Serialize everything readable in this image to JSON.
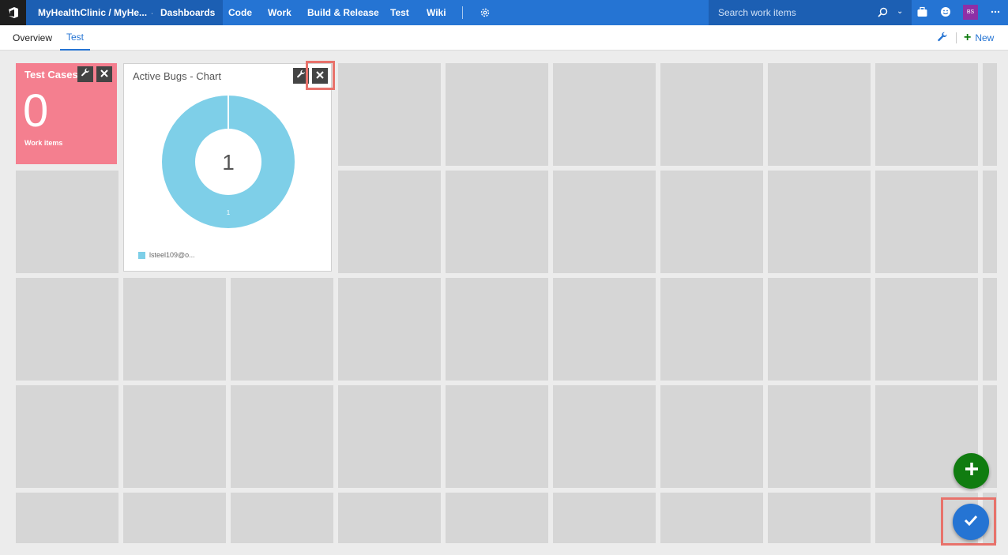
{
  "topbar": {
    "project": "MyHealthClinic / MyHe...",
    "nav": [
      "Dashboards",
      "Code",
      "Work",
      "Build & Release",
      "Test",
      "Wiki"
    ],
    "active_nav": "Dashboards",
    "search_placeholder": "Search work items",
    "avatar_initials": "BS",
    "colors": {
      "bar": "#2574d3",
      "bar_dark": "#1c5fb3",
      "avatar": "#8e2fa6"
    }
  },
  "subbar": {
    "tabs": [
      "Overview",
      "Test"
    ],
    "active_tab": "Test",
    "new_label": "New"
  },
  "widgets": {
    "test_cases": {
      "title": "Test Cases",
      "value": "0",
      "subtitle": "Work items",
      "color": "#f47f8f"
    },
    "active_bugs": {
      "title": "Active Bugs - Chart",
      "total": "1",
      "slice_label": "1",
      "legend": "lsteel109@o...",
      "color": "#7ecfe8"
    }
  },
  "chart_data": {
    "type": "pie",
    "title": "Active Bugs - Chart",
    "categories": [
      "lsteel109@o..."
    ],
    "values": [
      1
    ],
    "center_label": "1",
    "legend_position": "bottom-left"
  },
  "icons": [
    "vsts-logo-icon",
    "gear-icon",
    "search-icon",
    "briefcase-icon",
    "smiley-icon",
    "ellipsis-icon",
    "wrench-icon",
    "close-icon",
    "plus-icon",
    "check-icon"
  ]
}
